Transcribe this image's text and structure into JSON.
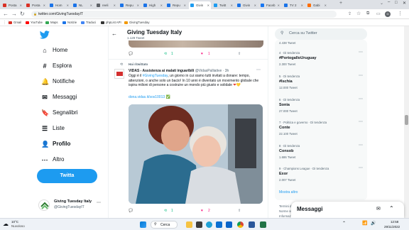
{
  "browser": {
    "tabs": [
      {
        "label": "Posta",
        "color": "#d93025"
      },
      {
        "label": "Posta",
        "color": "#d93025"
      },
      {
        "label": "Hom",
        "color": "#1a73e8"
      },
      {
        "label": "NL",
        "color": "#1a73e8"
      },
      {
        "label": "reeli",
        "color": "#5f6368"
      },
      {
        "label": "Repu",
        "color": "#1a73e8"
      },
      {
        "label": "High",
        "color": "#1a73e8"
      },
      {
        "label": "Repu",
        "color": "#1a73e8"
      },
      {
        "label": "Givin",
        "color": "#1d9bf0"
      },
      {
        "label": "Twitt",
        "color": "#1d9bf0"
      },
      {
        "label": "Givin",
        "color": "#1a73e8"
      },
      {
        "label": "Faceb",
        "color": "#1877f2"
      },
      {
        "label": "TV 2",
        "color": "#1a73e8"
      },
      {
        "label": "Gabi",
        "color": "#ff6d00"
      }
    ],
    "url": "twitter.com/GivingTuesdayIT",
    "bookmarks": [
      {
        "label": "Gmail",
        "color": "#d93025"
      },
      {
        "label": "YouTube",
        "color": "#ff0000"
      },
      {
        "label": "Maps",
        "color": "#34a853"
      },
      {
        "label": "Notizie",
        "color": "#1a73e8"
      },
      {
        "label": "Traduci",
        "color": "#4285f4"
      },
      {
        "label": "phpList API",
        "color": "#333333"
      },
      {
        "label": "GivingTuesday",
        "color": "#f29900"
      }
    ]
  },
  "nav": {
    "items": [
      {
        "label": "Home",
        "icon": "home-icon",
        "glyph": "⌂"
      },
      {
        "label": "Esplora",
        "icon": "hashtag-icon",
        "glyph": "#"
      },
      {
        "label": "Notifiche",
        "icon": "bell-icon",
        "glyph": "🔔"
      },
      {
        "label": "Messaggi",
        "icon": "mail-icon",
        "glyph": "✉"
      },
      {
        "label": "Segnalibri",
        "icon": "bookmark-icon",
        "glyph": "🔖"
      },
      {
        "label": "Liste",
        "icon": "list-icon",
        "glyph": "☰"
      },
      {
        "label": "Profilo",
        "icon": "profile-icon",
        "glyph": "👤"
      },
      {
        "label": "Altro",
        "icon": "more-icon",
        "glyph": "⋯"
      }
    ],
    "tweet_button": "Twitta",
    "account": {
      "name": "Giving Tuesday Italy",
      "handle": "@GivingTuesdayIT"
    }
  },
  "header": {
    "title": "Giving Tuesday Italy",
    "subtitle": "1.129 Tweet"
  },
  "prev_tweet": {
    "retweets": "1",
    "likes": "1"
  },
  "tweet": {
    "retweeted_by": "Hai ritwittato",
    "author": "VIDAS - Assistenza ai malati inguaribili",
    "handle": "@VidasPalliative",
    "time": "· 3h",
    "text_1": "Oggi è il ",
    "hashtag": "#GivingTuesday",
    "text_2": ", un giorno in cui siamo tutti invitati a donare: tempo, attenzioni, o anche solo un bacio! In 10 anni è diventato un movimento globale che ispira milioni di persone a costruire un mondo più giusto e solidale",
    "link": "dona.vidas.it/sos10013",
    "retweets": "1",
    "likes": "2"
  },
  "right": {
    "search_placeholder": "Cerca su Twitter",
    "top_count": "4.438 Tweet",
    "trends": [
      {
        "meta": "4 · Di tendenza",
        "title": "#PortogalloUruguay",
        "count": "2.300 Tweet"
      },
      {
        "meta": "5 · Di tendenza",
        "title": "#Ischia",
        "count": "12.000 Tweet"
      },
      {
        "meta": "6 · Di tendenza",
        "title": "Sonia",
        "count": "27.000 Tweet"
      },
      {
        "meta": "7 · Politica e governo · Di tendenza",
        "title": "Conte",
        "count": "22.100 Tweet"
      },
      {
        "meta": "8 · Di tendenza",
        "title": "Consob",
        "count": "1.686 Tweet"
      },
      {
        "meta": "9 · Champions League · Di tendenza",
        "title": "Exor",
        "count": "2.007 Tweet"
      }
    ],
    "show_more": "Mostra altro",
    "footer_1": "Termini di",
    "footer_2": "Norme sulla",
    "footer_3": "Informazioni"
  },
  "messages": {
    "title": "Messaggi"
  },
  "taskbar": {
    "weather_temp": "10°C",
    "weather_desc": "Nuvoloso",
    "search": "Cerca",
    "time": "12:58",
    "date": "29/11/2022"
  }
}
